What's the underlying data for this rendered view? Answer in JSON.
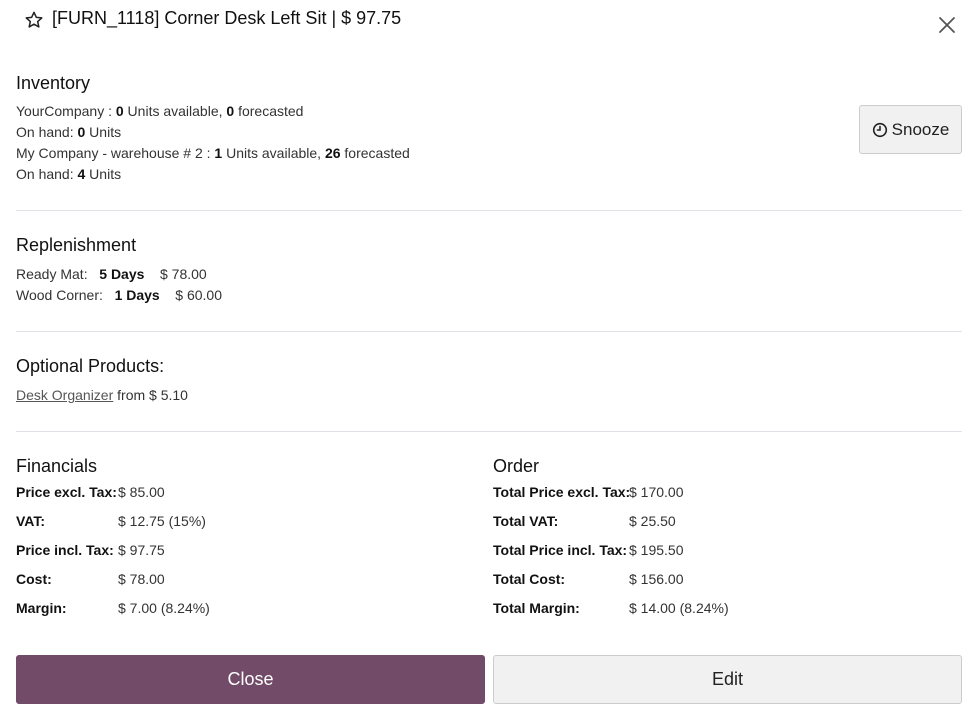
{
  "header": {
    "title": "[FURN_1118] Corner Desk Left Sit | $ 97.75"
  },
  "inventory": {
    "title": "Inventory",
    "lines": [
      {
        "prefix": "YourCompany : ",
        "units": "0",
        "units_text": " Units available, ",
        "forecast": "0",
        "forecast_text": " forecasted"
      },
      {
        "onhand_label": "On hand: ",
        "onhand_value": "0",
        "onhand_unit": " Units"
      },
      {
        "prefix": "My Company - warehouse # 2 : ",
        "units": "1",
        "units_text": " Units available, ",
        "forecast": "26",
        "forecast_text": " forecasted"
      },
      {
        "onhand_label": "On hand: ",
        "onhand_value": "4",
        "onhand_unit": " Units"
      }
    ],
    "snooze_label": "Snooze"
  },
  "replenishment": {
    "title": "Replenishment",
    "rows": [
      {
        "vendor": "Ready Mat:",
        "days": "5 Days",
        "price": "$ 78.00"
      },
      {
        "vendor": "Wood Corner:",
        "days": "1 Days",
        "price": "$ 60.00"
      }
    ]
  },
  "optional": {
    "title": "Optional Products:",
    "product": "Desk Organizer",
    "from_text": "from $ 5.10"
  },
  "financials": {
    "title": "Financials",
    "rows": [
      {
        "label": "Price excl. Tax:",
        "value": "$ 85.00"
      },
      {
        "label": "VAT:",
        "value": "$ 12.75 (15%)"
      },
      {
        "label": "Price incl. Tax:",
        "value": "$ 97.75"
      },
      {
        "label": "Cost:",
        "value": "$ 78.00"
      },
      {
        "label": "Margin:",
        "value": "$ 7.00 (8.24%)"
      }
    ]
  },
  "order": {
    "title": "Order",
    "rows": [
      {
        "label": "Total Price excl. Tax:",
        "value": "$ 170.00"
      },
      {
        "label": "Total VAT:",
        "value": "$ 25.50"
      },
      {
        "label": "Total Price incl. Tax:",
        "value": "$ 195.50"
      },
      {
        "label": "Total Cost:",
        "value": "$ 156.00"
      },
      {
        "label": "Total Margin:",
        "value": "$ 14.00 (8.24%)"
      }
    ]
  },
  "footer": {
    "close_label": "Close",
    "edit_label": "Edit"
  },
  "colors": {
    "primary": "#714b67",
    "divider": "#dee2e6"
  }
}
